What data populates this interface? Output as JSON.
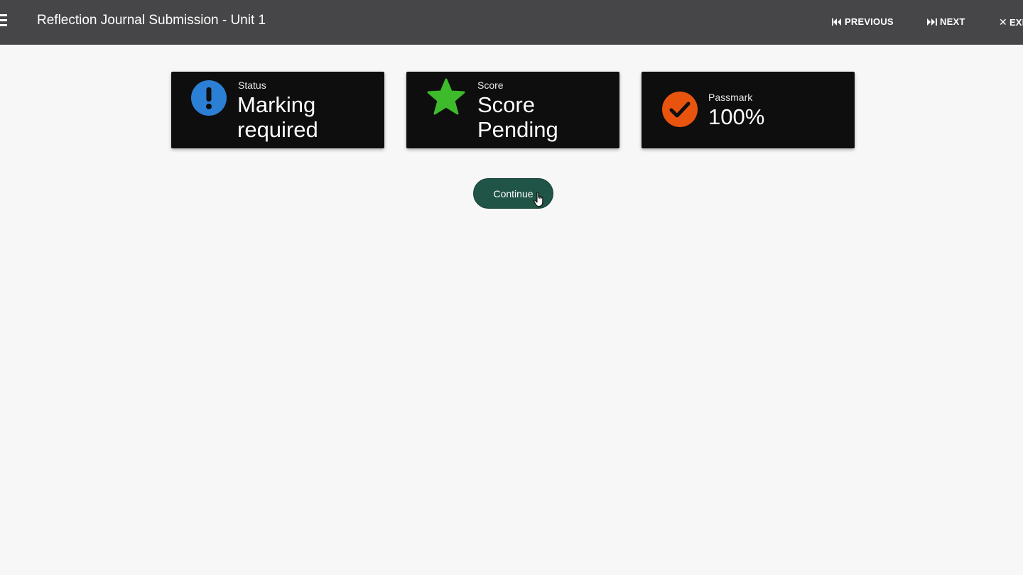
{
  "header": {
    "title": "Reflection Journal Submission - Unit 1",
    "previous_label": "PREVIOUS",
    "next_label": "NEXT",
    "exit_label": "EXIT"
  },
  "cards": [
    {
      "label": "Status",
      "value": "Marking required",
      "icon": "exclamation-circle-icon",
      "icon_color": "#2b7fd4"
    },
    {
      "label": "Score",
      "value": "Score Pending",
      "icon": "star-icon",
      "icon_color": "#3dbb2a"
    },
    {
      "label": "Passmark",
      "value": "100%",
      "icon": "check-circle-icon",
      "icon_color": "#e8540e"
    }
  ],
  "continue_label": "Continue",
  "colors": {
    "topbar": "#464648",
    "card_bg": "#0e0e0e",
    "continue_bg": "#1f5446",
    "page_bg": "#f7f7f7"
  }
}
